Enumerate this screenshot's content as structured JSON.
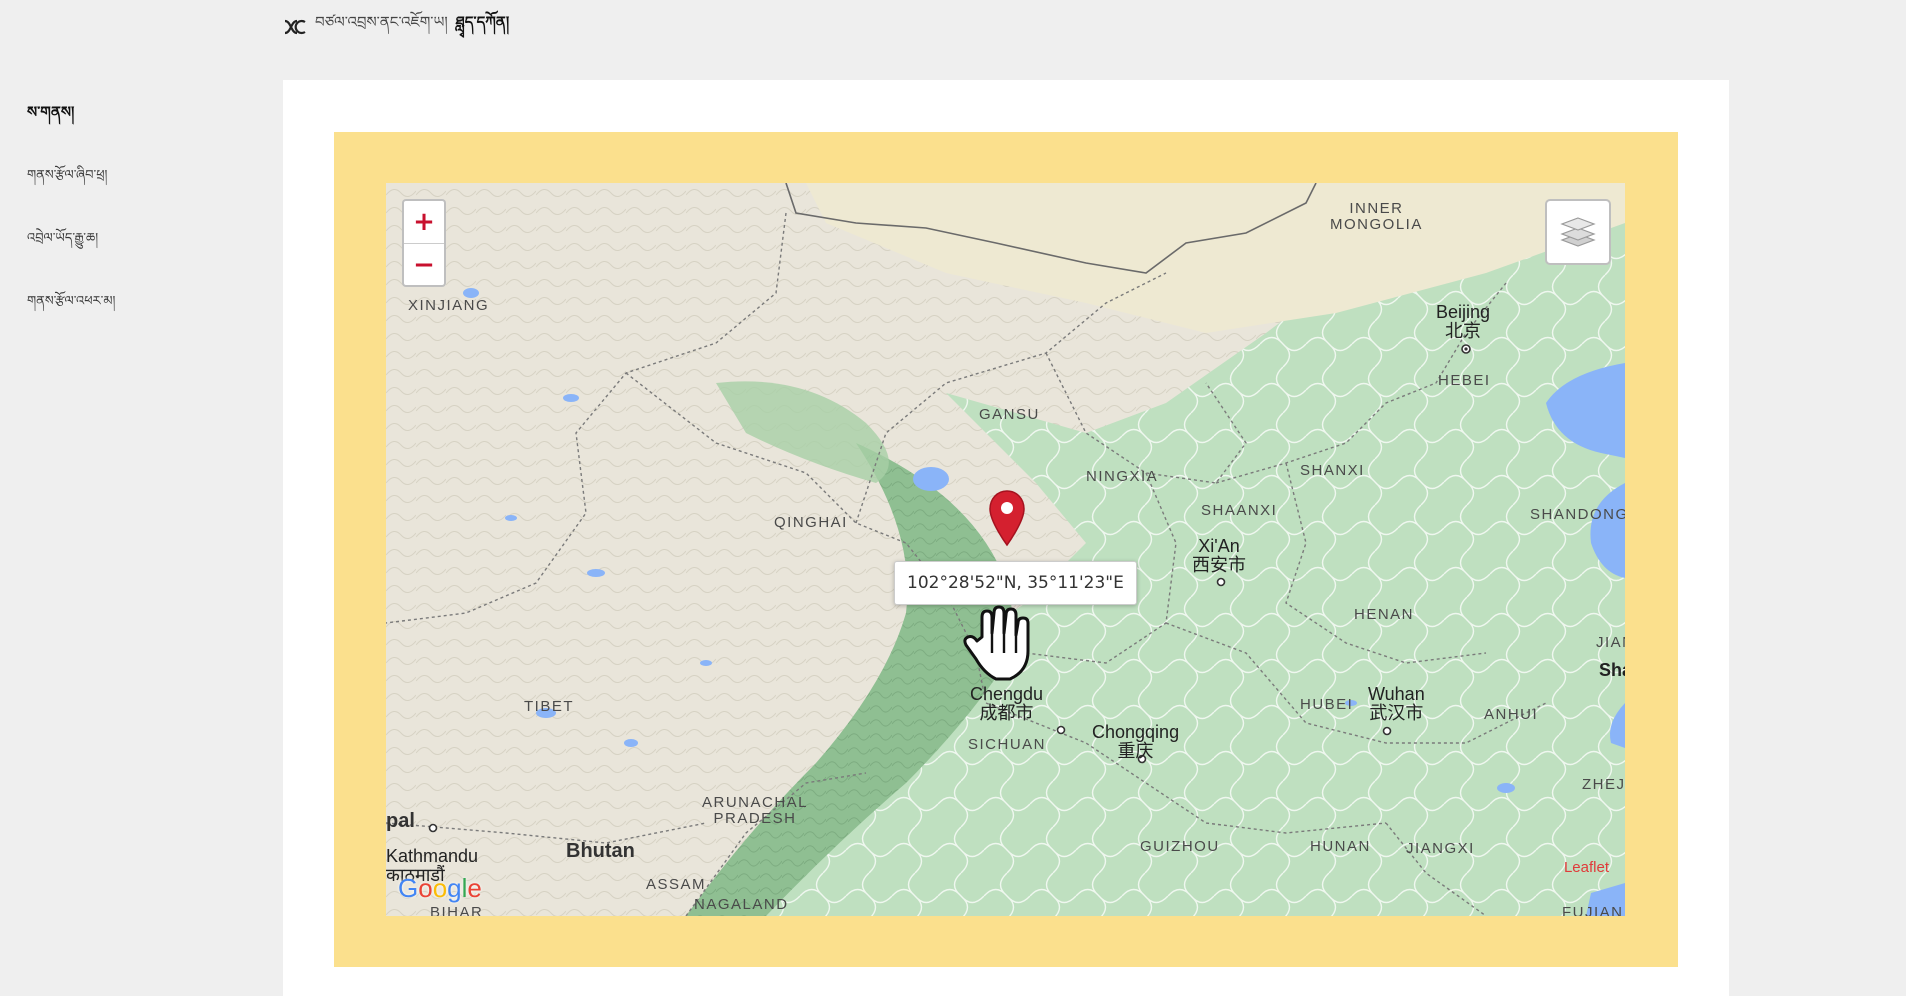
{
  "header": {
    "crumb": "བཙལ་འབྲས་ནང་འཇོག་ཡ།",
    "current": "ཐླྭད་དཀོན།"
  },
  "sidebar": {
    "title": "ས་གནས།",
    "items": [
      {
        "label": "གནས་རྩོལ་ཞིབ་ཕྲ།"
      },
      {
        "label": "འབྲེལ་ཡོད་རྒྱུ་ཆ།"
      },
      {
        "label": "གནས་རྩོལ་འཕར་མ།"
      }
    ]
  },
  "map": {
    "zoom_in": "+",
    "zoom_out": "−",
    "coordinates": "102°28'52\"N, 35°11'23\"E",
    "attribution": "Leaflet",
    "basemap_logo": [
      "G",
      "o",
      "o",
      "g",
      "l",
      "e"
    ],
    "marker_color": "#d4202f",
    "labels": {
      "xinjiang": "XINJIANG",
      "inner_mongolia": "INNER\nMONGOLIA",
      "gansu": "GANSU",
      "ningxia": "NINGXIA",
      "qinghai": "QINGHAI",
      "shaanxi": "SHAANXI",
      "shanxi": "SHANXI",
      "hebei": "HEBEI",
      "shandong": "SHANDONG",
      "henan": "HENAN",
      "jiangsu": "JIANGS",
      "hubei": "HUBEI",
      "anhui": "ANHUI",
      "zhejiang": "ZHEJIA",
      "tibet": "TIBET",
      "sichuan": "SICHUAN",
      "guizhou": "GUIZHOU",
      "hunan": "HUNAN",
      "jiangxi": "JIANGXI",
      "fujian": "FUJIAN",
      "arunachal": "ARUNACHAL\nPRADESH",
      "assam": "ASSAM",
      "nagaland": "NAGALAND",
      "bihar": "BIHAR",
      "bhutan": "Bhutan",
      "nepal": "pal",
      "beijing_en": "Beijing",
      "beijing_cn": "北京",
      "xian_en": "Xi'An",
      "xian_cn": "西安市",
      "chengdu_en": "Chengdu",
      "chengdu_cn": "成都市",
      "chongqing_en": "Chongqing",
      "chongqing_cn": "重庆",
      "wuhan_en": "Wuhan",
      "wuhan_cn": "武汉市",
      "kathmandu_en": "Kathmandu",
      "kathmandu_local": "काठमाडौं",
      "shanghai_partial": "Sha"
    }
  }
}
